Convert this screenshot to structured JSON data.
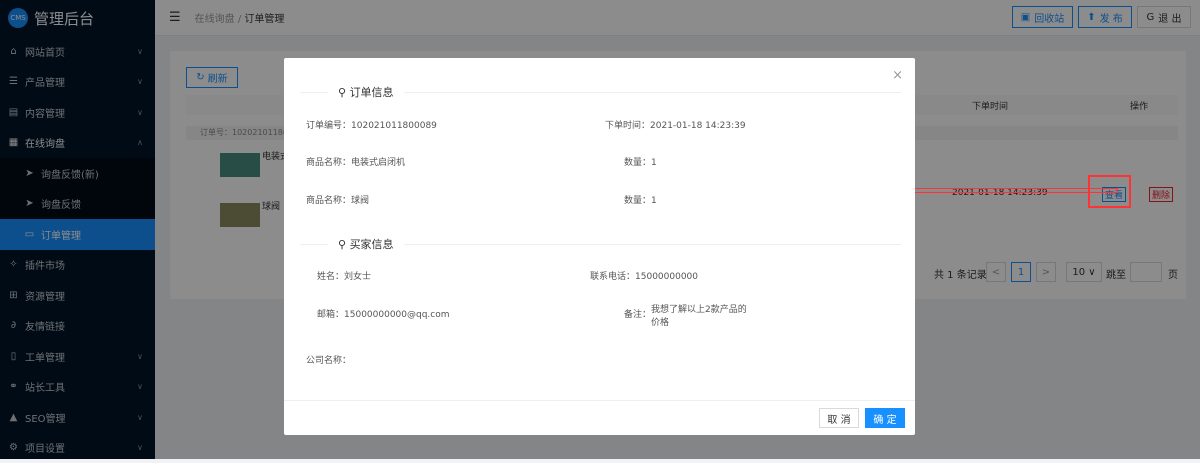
{
  "sidebar": {
    "logo_badge": "CMS",
    "title": "管理后台",
    "items": [
      {
        "label": "网站首页"
      },
      {
        "label": "产品管理"
      },
      {
        "label": "内容管理"
      },
      {
        "label": "在线询盘"
      },
      {
        "label": "询盘反馈(新)"
      },
      {
        "label": "询盘反馈"
      },
      {
        "label": "订单管理"
      },
      {
        "label": "插件市场"
      },
      {
        "label": "资源管理"
      },
      {
        "label": "友情链接"
      },
      {
        "label": "工单管理"
      },
      {
        "label": "站长工具"
      },
      {
        "label": "SEO管理"
      },
      {
        "label": "项目设置"
      }
    ]
  },
  "header": {
    "crumb1": "在线询盘",
    "sep": "/",
    "crumb2": "订单管理",
    "recycle": "回收站",
    "publish": "发 布",
    "logout": "退 出"
  },
  "table": {
    "refresh": "刷新",
    "col_time": "下单时间",
    "col_action": "操作",
    "order_no": "订单号：102021011800089",
    "p1": "电装式",
    "p2": "球阀",
    "time": "2021-01-18 14:23:39",
    "view": "查看",
    "delete": "删除",
    "total": "共 1 条记录",
    "prev": "<",
    "page": "1",
    "next": ">",
    "page_size": "10 ∨",
    "goto": "跳至",
    "page_unit": "页"
  },
  "modal": {
    "close": "×",
    "order_section": "订单信息",
    "order_no_label": "订单编号：",
    "order_no": "102021011800089",
    "time_label": "下单时间：",
    "time": "2021-01-18 14:23:39",
    "items": [
      {
        "name_label": "商品名称：",
        "name": "电装式启闭机",
        "qty_label": "数量：",
        "qty": "1"
      },
      {
        "name_label": "商品名称：",
        "name": "球阀",
        "qty_label": "数量：",
        "qty": "1"
      }
    ],
    "buyer_section": "买家信息",
    "name_label": "姓名：",
    "name": "刘女士",
    "phone_label": "联系电话：",
    "phone": "15000000000",
    "email_label": "邮箱：",
    "email": "15000000000@qq.com",
    "note_label": "备注：",
    "note1": "我想了解以上2款产品的",
    "note2": "价格",
    "company_label": "公司名称：",
    "cancel": "取 消",
    "ok": "确 定"
  }
}
